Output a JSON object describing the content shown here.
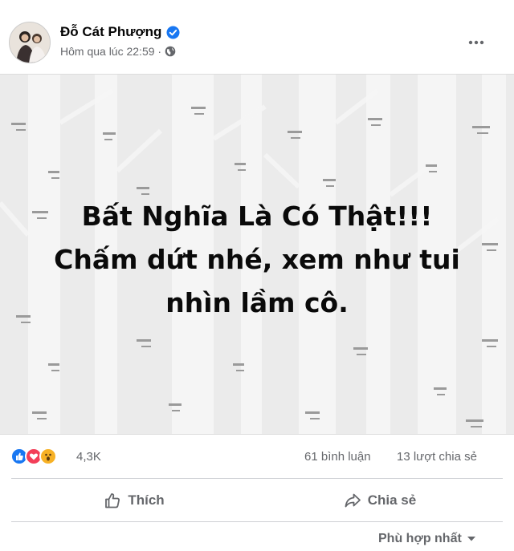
{
  "post": {
    "author": "Đỗ Cát Phượng",
    "timestamp": "Hôm qua lúc 22:59 ·",
    "audience_icon": "globe-icon",
    "more_icon": "more-options-icon",
    "image_text": {
      "line1": "Bất Nghĩa Là Có Thật!!!",
      "line2": "Chấm dứt nhé, xem như tui",
      "line3": "nhìn lầm cô."
    }
  },
  "stats": {
    "reactions": [
      "like",
      "love",
      "wow"
    ],
    "reaction_count": "4,3K",
    "comments": "61 bình luận",
    "shares": "13 lượt chia sẻ"
  },
  "actions": {
    "like_label": "Thích",
    "share_label": "Chia sẻ"
  },
  "comments_sort": {
    "label": "Phù hợp nhất"
  },
  "colors": {
    "verified": "#1877f2",
    "secondary_text": "#65676b",
    "like": "#1877f2",
    "love": "#f33e58",
    "wow": "#f7b125"
  }
}
